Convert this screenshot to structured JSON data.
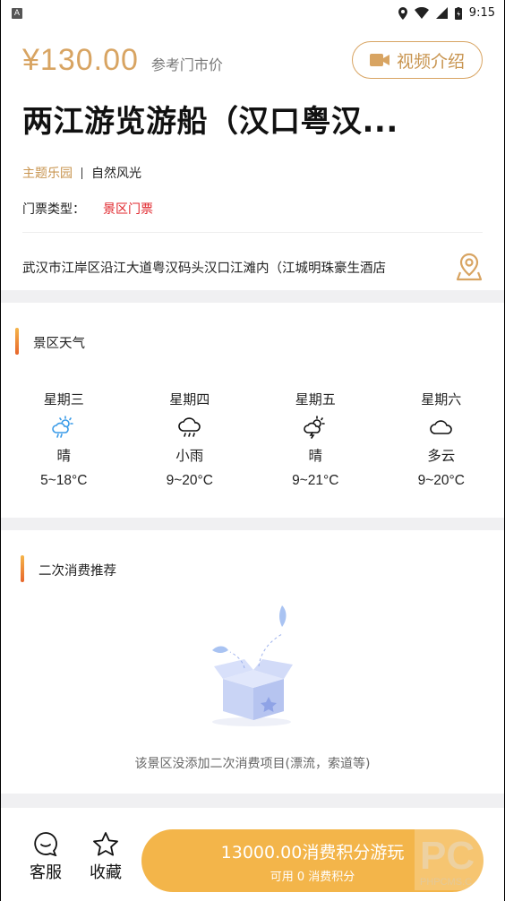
{
  "status_bar": {
    "app_badge": "A",
    "time": "9:15"
  },
  "header": {
    "price": "¥130.00",
    "price_ref_label": "参考门市价",
    "video_button_label": "视频介绍",
    "title": "两江游览游船（汉口粤汉...",
    "tag_primary": "主题乐园",
    "tag_secondary": "自然风光",
    "ticket_type_label": "门票类型：",
    "ticket_type_value": "景区门票",
    "address": "武汉市江岸区沿江大道粤汉码头汉口江滩内（江城明珠豪生酒店"
  },
  "weather_section": {
    "title": "景区天气",
    "days": [
      {
        "weekday": "星期三",
        "icon": "sun-cloud-rain-icon",
        "desc": "晴",
        "temp": "5~18°C"
      },
      {
        "weekday": "星期四",
        "icon": "cloud-rain-icon",
        "desc": "小雨",
        "temp": "9~20°C"
      },
      {
        "weekday": "星期五",
        "icon": "sun-cloud-lightning-icon",
        "desc": "晴",
        "temp": "9~21°C"
      },
      {
        "weekday": "星期六",
        "icon": "cloud-icon",
        "desc": "多云",
        "temp": "9~20°C"
      }
    ]
  },
  "recommend_section": {
    "title": "二次消费推荐",
    "empty_text": "该景区没添加二次消费项目(漂流，索道等)"
  },
  "bottom_bar": {
    "service_label": "客服",
    "favorite_label": "收藏",
    "cta_main": "13000.00消费积分游玩",
    "cta_sub": "可用 0 消费积分",
    "watermark_text": "PHPCMS.C"
  },
  "colors": {
    "accent": "#d8a462",
    "cta": "#f3b54a",
    "ticket_red": "#e0252b"
  }
}
